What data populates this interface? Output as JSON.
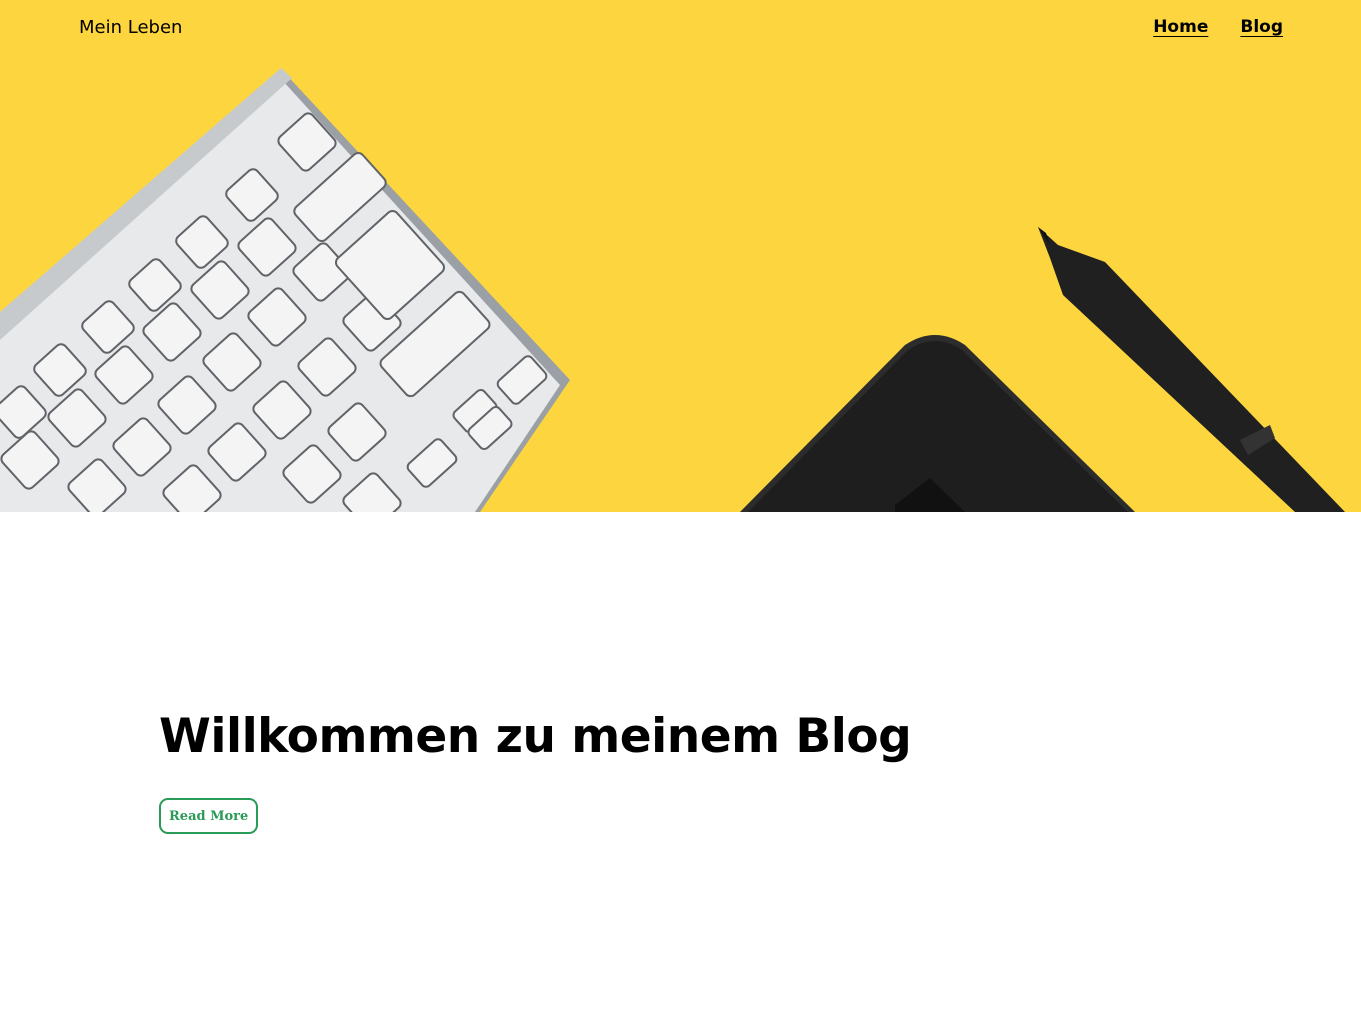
{
  "header": {
    "brand": "Mein Leben",
    "nav": [
      {
        "label": "Home"
      },
      {
        "label": "Blog"
      }
    ]
  },
  "hero": {
    "image_description_icon": "keyboard-and-pen-tablet-photo",
    "background_color": "#fcd53f"
  },
  "main": {
    "title": "Willkommen zu meinem Blog",
    "read_more_label": "Read More",
    "accent_color": "#2a9a57"
  }
}
